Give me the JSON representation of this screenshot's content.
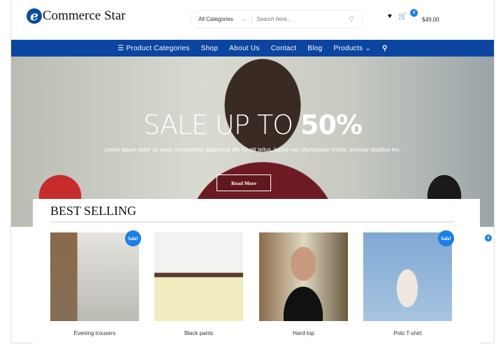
{
  "header": {
    "logo_letter": "e",
    "logo_text": "Commerce Star",
    "category_select": "All Categories",
    "search_placeholder": "Search here...",
    "cart_count": "4",
    "cart_total": "$49.00"
  },
  "nav": {
    "items": [
      "Product Categories",
      "Shop",
      "About Us",
      "Contact",
      "Blog",
      "Products"
    ]
  },
  "hero": {
    "title_light": "SALE UP TO ",
    "title_bold": "50%",
    "text": "Lorem ipsum dolor sit amet, consectetur adipiscing elit. Ut elit tellus, luctus nec ullamcorper mattis, pulvinar dapibus leo.",
    "button": "Read More"
  },
  "best_selling": {
    "title": "BEST SELLING",
    "sale_label": "Sale!",
    "products": [
      {
        "name": "Evening trousers",
        "sale": true
      },
      {
        "name": "Black pants",
        "sale": false
      },
      {
        "name": "Hard top",
        "sale": false
      },
      {
        "name": "Polo T-shirt",
        "sale": true
      }
    ]
  },
  "floating_cart_count": "4",
  "colors": {
    "brand": "#0b45a0",
    "accent": "#1f7ee6"
  }
}
